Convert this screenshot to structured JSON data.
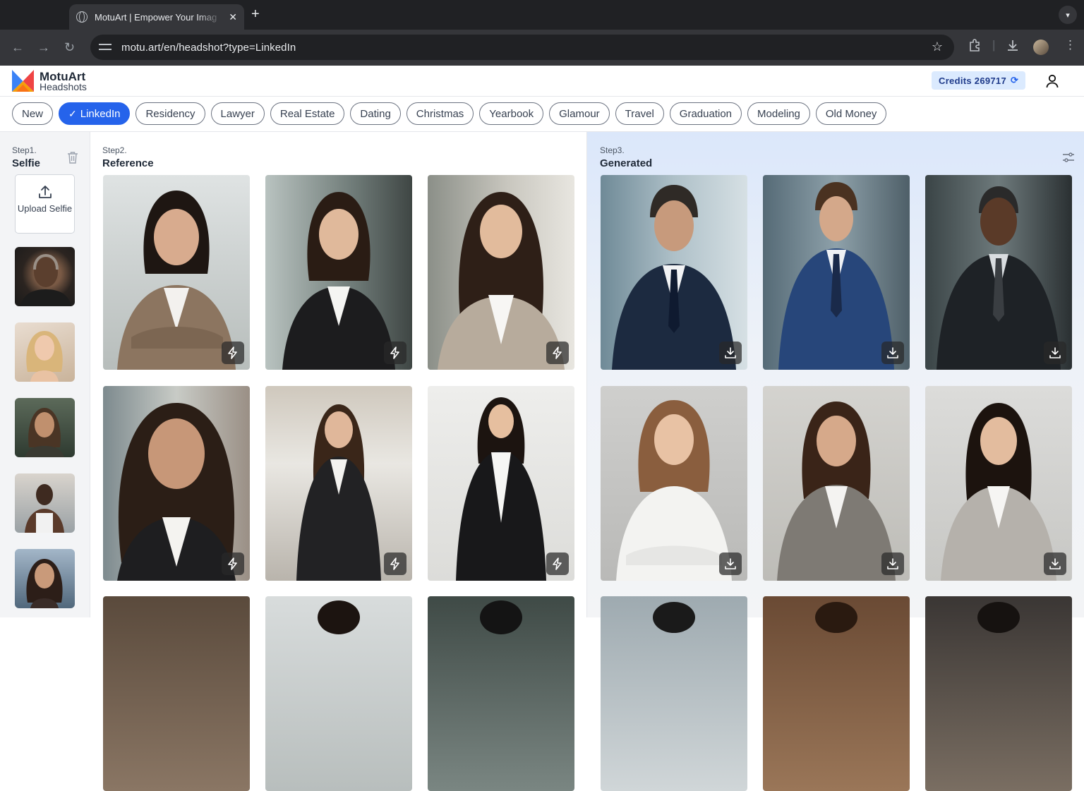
{
  "browser": {
    "tab_title": "MotuArt | Empower Your Imag",
    "url": "motu.art/en/headshot?type=LinkedIn"
  },
  "app": {
    "brand_title": "MotuArt",
    "brand_subtitle": "Headshots",
    "credits_label": "Credits 269717",
    "accent_color": "#2563eb"
  },
  "categories": [
    {
      "label": "New",
      "active": false
    },
    {
      "label": "LinkedIn",
      "active": true
    },
    {
      "label": "Residency",
      "active": false
    },
    {
      "label": "Lawyer",
      "active": false
    },
    {
      "label": "Real Estate",
      "active": false
    },
    {
      "label": "Dating",
      "active": false
    },
    {
      "label": "Christmas",
      "active": false
    },
    {
      "label": "Yearbook",
      "active": false
    },
    {
      "label": "Glamour",
      "active": false
    },
    {
      "label": "Travel",
      "active": false
    },
    {
      "label": "Graduation",
      "active": false
    },
    {
      "label": "Modeling",
      "active": false
    },
    {
      "label": "Old Money",
      "active": false
    }
  ],
  "step1": {
    "label": "Step1.",
    "title": "Selfie",
    "upload_label": "Upload Selfie",
    "selfies": [
      "selfie-older-man",
      "selfie-blonde-woman",
      "selfie-long-haired-man",
      "selfie-man-tank-top",
      "selfie-dark-haired-woman"
    ]
  },
  "step2": {
    "label": "Step2.",
    "title": "Reference",
    "action_icon": "lightning-icon"
  },
  "step3": {
    "label": "Step3.",
    "title": "Generated",
    "action_icon": "download-icon"
  }
}
